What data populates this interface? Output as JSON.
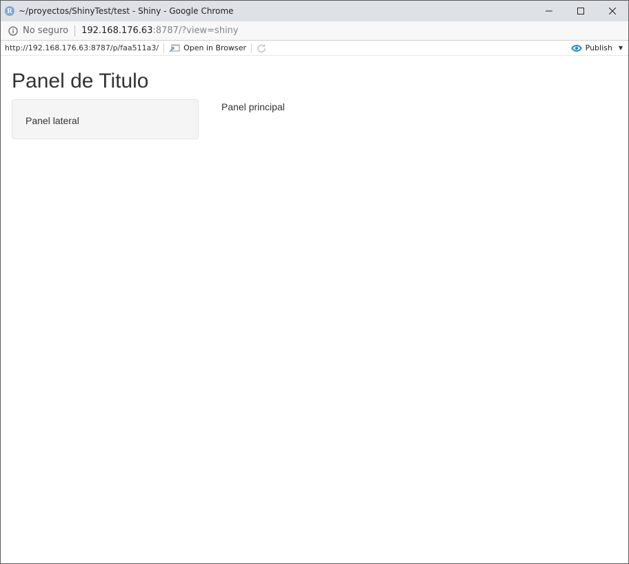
{
  "window": {
    "title": "~/proyectos/ShinyTest/test - Shiny - Google Chrome",
    "app_icon_letter": "R"
  },
  "addressbar": {
    "security_label": "No seguro",
    "url_host": "192.168.176.63",
    "url_rest": ":8787/?view=shiny"
  },
  "viewer_toolbar": {
    "url": "http://192.168.176.63:8787/p/faa511a3/",
    "open_in_browser": "Open in Browser",
    "publish": "Publish",
    "publish_color": "#1a87c9"
  },
  "app": {
    "title": "Panel de Titulo",
    "sidebar_text": "Panel lateral",
    "main_text": "Panel principal"
  }
}
